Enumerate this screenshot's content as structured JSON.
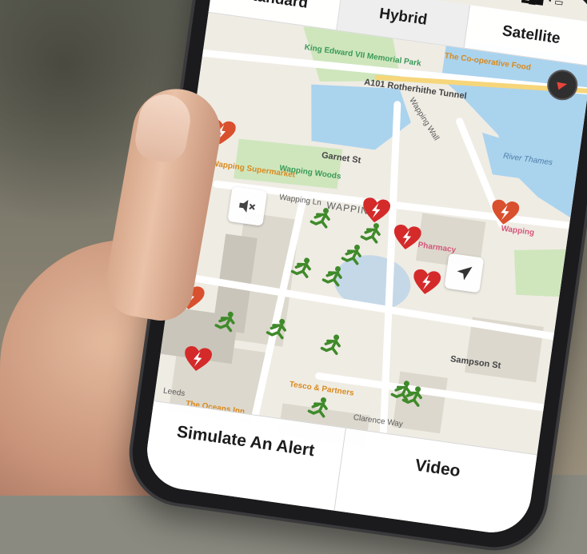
{
  "map_type_control": {
    "options": [
      "Standard",
      "Hybrid",
      "Satellite"
    ],
    "selected": "Hybrid"
  },
  "map": {
    "labels": {
      "coop_food": "The Co-operative Food",
      "king_edward": "King Edward VII Memorial Park",
      "rotherhithe_tunnel": "A101 Rotherhithe Tunnel",
      "river_thames": "River Thames",
      "wapping_wall": "Wapping Wall",
      "garnet_st": "Garnet St",
      "wapping_woods": "Wapping Woods",
      "wapping_supermarket": "Wapping Supermarket",
      "wapping_station": "Wapping",
      "wapping_district": "WAPPING",
      "wapping_lane": "Wapping Ln",
      "pharmacy": "Pharmacy",
      "sampson_st": "Sampson St",
      "tesco": "Tesco & Partners",
      "clarence_way": "Clarence Way",
      "the_oceans_inn": "The Oceans Inn",
      "leeds": "Leeds"
    }
  },
  "controls": {
    "mute_icon": "speaker-mute-icon",
    "locate_icon": "location-arrow-icon",
    "compass_icon": "compass-icon"
  },
  "bottom_bar": {
    "simulate_label": "Simulate An Alert",
    "video_label": "Video"
  },
  "colors": {
    "defib_marker": "#d9502e",
    "defib_marker_red": "#d42a2a",
    "responder": "#3f8a2a",
    "water": "#aad3ee",
    "park": "#cfe6bd"
  }
}
